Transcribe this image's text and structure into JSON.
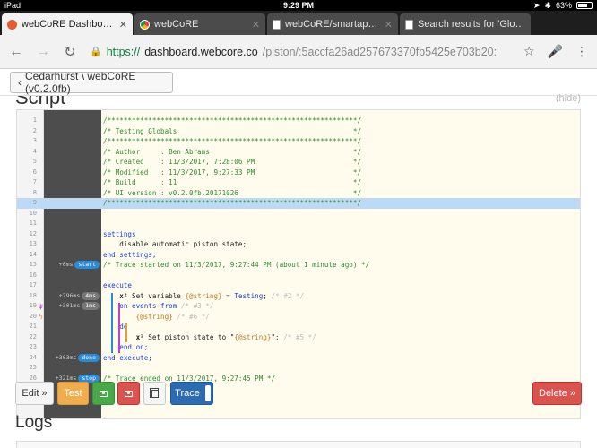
{
  "status": {
    "device": "iPad",
    "time": "9:29 PM",
    "battery": "63%"
  },
  "tabs": [
    {
      "title": "webCoRE Dashboard",
      "icon": "webcore-icon",
      "active": true
    },
    {
      "title": "webCoRE",
      "icon": "chrome-icon",
      "active": false
    },
    {
      "title": "webCoRE/smartapps/a",
      "icon": "document-icon",
      "active": false
    },
    {
      "title": "Search results for 'Globa",
      "icon": "document-icon",
      "active": false
    }
  ],
  "url": {
    "scheme": "https://",
    "host": "dashboard.webcore.co",
    "path": "/piston/:5accfa26ad257673370fb5425e703b20:"
  },
  "page": {
    "back_label": "Cedarhurst \\ webCoRE (v0.2.0fb)",
    "script_title": "Script",
    "hide_label": "(hide)",
    "logs_title": "Logs"
  },
  "code_lines": [
    {
      "n": "1",
      "text": "/*************************************************************/",
      "cls": "c-com"
    },
    {
      "n": "2",
      "text": "/* Testing Globals                                           */",
      "cls": "c-com"
    },
    {
      "n": "3",
      "text": "/*************************************************************/",
      "cls": "c-com"
    },
    {
      "n": "4",
      "text": "/* Author     : Ben Abrams                                   */",
      "cls": "c-com"
    },
    {
      "n": "5",
      "text": "/* Created    : 11/3/2017, 7:28:06 PM                        */",
      "cls": "c-com"
    },
    {
      "n": "6",
      "text": "/* Modified   : 11/3/2017, 9:27:33 PM                        */",
      "cls": "c-com"
    },
    {
      "n": "7",
      "text": "/* Build      : 11                                           */",
      "cls": "c-com"
    },
    {
      "n": "8",
      "text": "/* UI version : v0.2.0fb.20171026                            */",
      "cls": "c-com"
    },
    {
      "n": "9",
      "text": "/*************************************************************/",
      "cls": "c-com",
      "hl": true
    },
    {
      "n": "10",
      "text": ""
    },
    {
      "n": "11",
      "text": ""
    },
    {
      "n": "12",
      "text": "settings",
      "cls": "c-kw"
    },
    {
      "n": "13",
      "text": "    disable automatic piston state;",
      "cls": "c-pl"
    },
    {
      "n": "14",
      "text": "end settings;",
      "cls": "c-kw"
    },
    {
      "n": "15",
      "text": "/* Trace started on 11/3/2017, 9:27:44 PM (about 1 minute ago) */",
      "cls": "c-com",
      "trace_time": "+0ms",
      "trace_badge": "start",
      "badge_color": "blue"
    },
    {
      "n": "16",
      "text": ""
    },
    {
      "n": "17",
      "text": "execute",
      "cls": "c-kw"
    },
    {
      "n": "18",
      "parts": [
        [
          "    ",
          "c-pl"
        ],
        [
          "x² ",
          "c-pl x2"
        ],
        [
          "Set variable ",
          "c-pl"
        ],
        [
          "{@string}",
          "c-var"
        ],
        [
          " = ",
          "c-pl"
        ],
        [
          "Testing",
          "c-kw"
        ],
        [
          "; ",
          "c-pl"
        ],
        [
          "/* #2 */",
          "c-dim"
        ]
      ],
      "trace_time": "+296ms",
      "trace_badge": "4ms",
      "badge_color": "gray"
    },
    {
      "n": "19",
      "parts": [
        [
          "    on events from ",
          "c-kw"
        ],
        [
          "/* #3 */",
          "c-dim"
        ]
      ],
      "trace_time": "+301ms",
      "trace_badge": "1ms",
      "badge_color": "gray",
      "marker": "ψ"
    },
    {
      "n": "20",
      "parts": [
        [
          "        ",
          "c-pl"
        ],
        [
          "{@string}",
          "c-var"
        ],
        [
          " /* #6 */",
          "c-dim"
        ]
      ],
      "marker": "ϟ"
    },
    {
      "n": "21",
      "text": "    do",
      "cls": "c-kw"
    },
    {
      "n": "22",
      "parts": [
        [
          "        ",
          "c-pl"
        ],
        [
          "x² ",
          "c-pl x2"
        ],
        [
          "Set piston state to \"",
          "c-pl"
        ],
        [
          "{@string}",
          "c-var"
        ],
        [
          "\"; ",
          "c-pl"
        ],
        [
          "/* #5 */",
          "c-dim"
        ]
      ]
    },
    {
      "n": "23",
      "text": "    end on;",
      "cls": "c-kw"
    },
    {
      "n": "24",
      "text": "end execute;",
      "cls": "c-kw",
      "trace_time": "+303ms",
      "trace_badge": "done",
      "badge_color": "blue"
    },
    {
      "n": "25",
      "text": ""
    },
    {
      "n": "26",
      "text": "/* Trace ended on 11/3/2017, 9:27:45 PM */",
      "cls": "c-com",
      "trace_time": "+321ms",
      "trace_badge": "stop",
      "badge_color": "blue"
    }
  ],
  "buttons": {
    "edit": "Edit »",
    "test": "Test",
    "trace": "Trace",
    "delete": "Delete »"
  },
  "colors": {
    "accent_blue": "#2a8bd8",
    "code_bg": "#fffcee",
    "comment": "#2e8b2e",
    "keyword": "#1a3fd8"
  }
}
